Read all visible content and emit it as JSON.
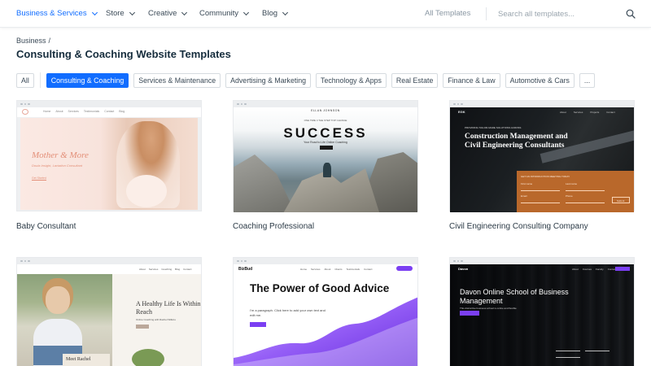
{
  "nav": {
    "items": [
      {
        "label": "Business & Services",
        "active": true
      },
      {
        "label": "Store"
      },
      {
        "label": "Creative"
      },
      {
        "label": "Community"
      },
      {
        "label": "Blog"
      }
    ],
    "all_templates": "All Templates",
    "search_placeholder": "Search all templates...",
    "search_icon": "search-icon"
  },
  "breadcrumb": {
    "parent": "Business",
    "separator": "/"
  },
  "page_title": "Consulting & Coaching Website Templates",
  "filters": {
    "all": "All",
    "chips": [
      {
        "label": "Consulting & Coaching",
        "active": true
      },
      {
        "label": "Services & Maintenance"
      },
      {
        "label": "Advertising & Marketing"
      },
      {
        "label": "Technology & Apps"
      },
      {
        "label": "Real Estate"
      },
      {
        "label": "Finance & Law"
      },
      {
        "label": "Automotive & Cars"
      }
    ],
    "more": "..."
  },
  "colors": {
    "accent": "#116dff",
    "text": "#20303c",
    "muted": "#8a97a3",
    "purple": "#7b3ff2",
    "orange": "#b9682b"
  },
  "templates": [
    {
      "name": "Baby Consultant",
      "preview": {
        "menu": [
          "Home",
          "About",
          "Services",
          "Testimonials",
          "Contact",
          "Blog"
        ],
        "title": "Mother & More",
        "subtitle": "Doula Insight, Lactation Consultant",
        "button": "Get Started"
      }
    },
    {
      "name": "Coaching Professional",
      "preview": {
        "header": "ELLAN JOHNSON",
        "tagline": "ONE TIME 4 THE STEP TOP CHANGE",
        "headline": "SUCCESS",
        "subline": "Your Road to Life Online Coaching",
        "button": "Book Now"
      }
    },
    {
      "name": "Civil Engineering Consulting Company",
      "preview": {
        "logo": "EGK",
        "menu": [
          "About",
          "Services",
          "Projects",
          "Contact"
        ],
        "tag": "PROVIDING TAILOR-MADE SOLUTIONS ACROSS",
        "title": "Construction Management and Civil Engineering Consultants",
        "form_title": "GET AN INTRODUCTION MEETING TODAY",
        "form_fields": [
          "First name",
          "Last name",
          "Email",
          "Phone"
        ],
        "submit": "Submit"
      }
    },
    {
      "name": "",
      "preview": {
        "menu": [
          "About",
          "Services",
          "Coaching",
          "Blog",
          "Contact"
        ],
        "title": "A Healthy Life Is Within Reach",
        "subtitle": "Online Coaching with Rachel Wilkins",
        "meet": "Meet Rachel"
      }
    },
    {
      "name": "",
      "preview": {
        "logo": "BizBud",
        "menu": [
          "Home",
          "Services",
          "About",
          "Clients",
          "Testimonials",
          "Contact"
        ],
        "title": "The Power of Good Advice",
        "subtitle": "I'm a paragraph. Click here to add your own text and edit me.",
        "button": "Learn More"
      }
    },
    {
      "name": "",
      "preview": {
        "logo": "Davon",
        "menu": [
          "About",
          "Courses",
          "Faculty",
          "Contact"
        ],
        "title": "Davon Online School of Business Management",
        "subtitle": "This distinctive business school is online and flexible",
        "button": "Enroll Now"
      }
    }
  ]
}
